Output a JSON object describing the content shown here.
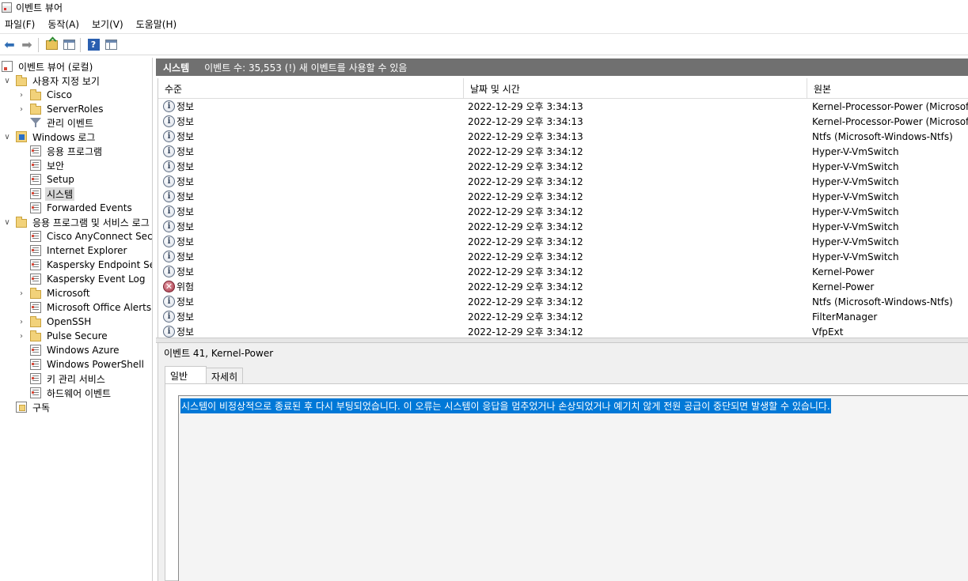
{
  "window": {
    "title": "이벤트 뷰어"
  },
  "menu": [
    "파일(F)",
    "동작(A)",
    "보기(V)",
    "도움말(H)"
  ],
  "tree": {
    "root": "이벤트 뷰어 (로컬)",
    "custom_views": "사용자 지정 보기",
    "cisco": "Cisco",
    "server_roles": "ServerRoles",
    "admin_events": "관리 이벤트",
    "windows_logs": "Windows 로그",
    "application": "응용 프로그램",
    "security": "보안",
    "setup": "Setup",
    "system": "시스템",
    "forwarded": "Forwarded Events",
    "apps_services": "응용 프로그램 및 서비스 로그",
    "cisco_anyconnect": "Cisco AnyConnect Secure Mobility Client",
    "internet_explorer": "Internet Explorer",
    "kaspersky_endpoint": "Kaspersky Endpoint Security",
    "kaspersky_event_log": "Kaspersky Event Log",
    "microsoft": "Microsoft",
    "office_alerts": "Microsoft Office Alerts",
    "openssh": "OpenSSH",
    "pulse_secure": "Pulse Secure",
    "windows_azure": "Windows Azure",
    "windows_powershell": "Windows PowerShell",
    "key_management": "키 관리 서비스",
    "hardware_events": "하드웨어 이벤트",
    "subscriptions": "구독"
  },
  "header": {
    "log_name": "시스템",
    "summary": "이벤트 수: 35,553 (!) 새 이벤트를 사용할 수 있음"
  },
  "grid": {
    "columns": [
      "수준",
      "날짜 및 시간",
      "원본"
    ],
    "rows": [
      {
        "level": "정보",
        "type": "info",
        "datetime": "2022-12-29 오후 3:34:13",
        "source": "Kernel-Processor-Power (Microsoft-Windows-Kernel-Processor-Power)"
      },
      {
        "level": "정보",
        "type": "info",
        "datetime": "2022-12-29 오후 3:34:13",
        "source": "Kernel-Processor-Power (Microsoft-Windows-Kernel-Processor-Power)"
      },
      {
        "level": "정보",
        "type": "info",
        "datetime": "2022-12-29 오후 3:34:13",
        "source": "Ntfs (Microsoft-Windows-Ntfs)"
      },
      {
        "level": "정보",
        "type": "info",
        "datetime": "2022-12-29 오후 3:34:12",
        "source": "Hyper-V-VmSwitch"
      },
      {
        "level": "정보",
        "type": "info",
        "datetime": "2022-12-29 오후 3:34:12",
        "source": "Hyper-V-VmSwitch"
      },
      {
        "level": "정보",
        "type": "info",
        "datetime": "2022-12-29 오후 3:34:12",
        "source": "Hyper-V-VmSwitch"
      },
      {
        "level": "정보",
        "type": "info",
        "datetime": "2022-12-29 오후 3:34:12",
        "source": "Hyper-V-VmSwitch"
      },
      {
        "level": "정보",
        "type": "info",
        "datetime": "2022-12-29 오후 3:34:12",
        "source": "Hyper-V-VmSwitch"
      },
      {
        "level": "정보",
        "type": "info",
        "datetime": "2022-12-29 오후 3:34:12",
        "source": "Hyper-V-VmSwitch"
      },
      {
        "level": "정보",
        "type": "info",
        "datetime": "2022-12-29 오후 3:34:12",
        "source": "Hyper-V-VmSwitch"
      },
      {
        "level": "정보",
        "type": "info",
        "datetime": "2022-12-29 오후 3:34:12",
        "source": "Hyper-V-VmSwitch"
      },
      {
        "level": "정보",
        "type": "info",
        "datetime": "2022-12-29 오후 3:34:12",
        "source": "Kernel-Power"
      },
      {
        "level": "위험",
        "type": "critical",
        "datetime": "2022-12-29 오후 3:34:12",
        "source": "Kernel-Power"
      },
      {
        "level": "정보",
        "type": "info",
        "datetime": "2022-12-29 오후 3:34:12",
        "source": "Ntfs (Microsoft-Windows-Ntfs)"
      },
      {
        "level": "정보",
        "type": "info",
        "datetime": "2022-12-29 오후 3:34:12",
        "source": "FilterManager"
      },
      {
        "level": "정보",
        "type": "info",
        "datetime": "2022-12-29 오후 3:34:12",
        "source": "VfpExt"
      }
    ]
  },
  "details": {
    "title": "이벤트 41, Kernel-Power",
    "tab_general": "일반",
    "tab_details": "자세히",
    "description": "시스템이 비정상적으로 종료된 후 다시 부팅되었습니다. 이 오류는 시스템이 응답을 멈추었거나 손상되었거나 예기치 않게 전원 공급이 중단되면 발생할 수 있습니다."
  }
}
